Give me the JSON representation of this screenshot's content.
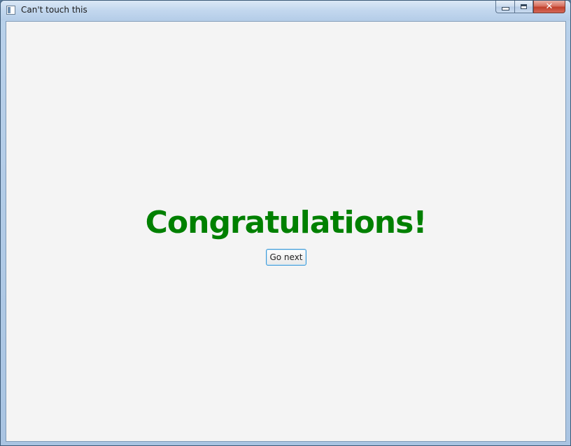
{
  "window": {
    "title": "Can't touch this",
    "icon": "app-window-icon",
    "caption_buttons": {
      "minimize_icon": "minimize-icon",
      "maximize_icon": "maximize-icon",
      "close_label": "✕"
    }
  },
  "content": {
    "heading": "Congratulations!",
    "heading_color": "#008000",
    "go_next_label": "Go next",
    "background_color": "#f4f4f4"
  }
}
